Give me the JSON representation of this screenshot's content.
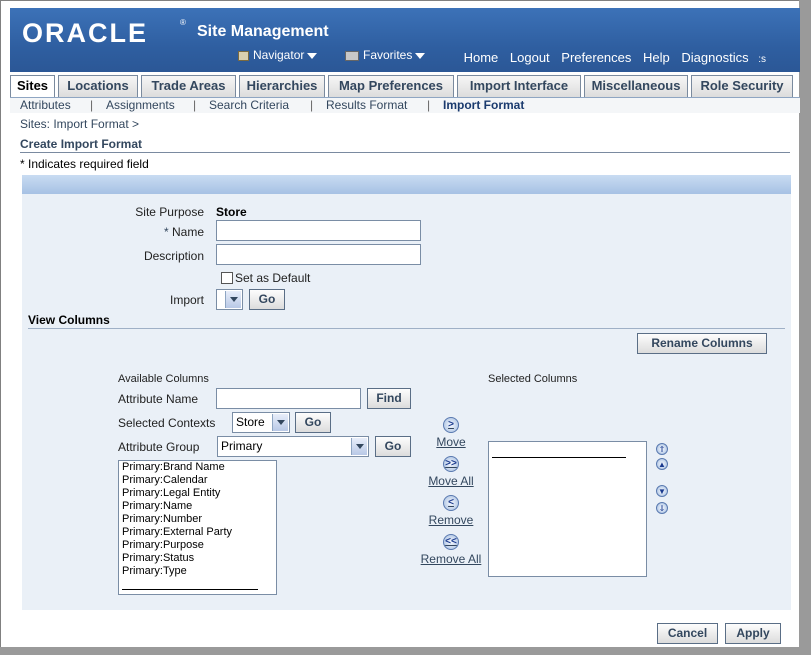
{
  "header": {
    "logo_text": "ORACLE",
    "logo_tm": "®",
    "app_title": "Site Management",
    "navigator_label": "Navigator",
    "favorites_label": "Favorites",
    "links": [
      "Home",
      "Logout",
      "Preferences",
      "Help",
      "Diagnostics"
    ],
    "overflow": ":s"
  },
  "tabs": [
    "Sites",
    "Locations",
    "Trade Areas",
    "Hierarchies",
    "Map Preferences",
    "Import Interface",
    "Miscellaneous",
    "Role Security"
  ],
  "subtabs": [
    "Attributes",
    "Assignments",
    "Search Criteria",
    "Results Format",
    "Import Format"
  ],
  "breadcrumb": "Sites: Import Format  >",
  "page_title": "Create Import Format",
  "required_note": "*  Indicates required field",
  "form": {
    "site_purpose_label": "Site Purpose",
    "site_purpose_value": "Store",
    "name_label": "Name",
    "name_required": "*",
    "name_value": "",
    "description_label": "Description",
    "description_value": "",
    "set_default_label": "Set as Default",
    "import_label": "Import",
    "go_label": "Go"
  },
  "view_columns": {
    "title": "View Columns",
    "rename_button": "Rename Columns",
    "available_label": "Available Columns",
    "selected_label": "Selected Columns",
    "attribute_name_label": "Attribute Name",
    "attribute_name_value": "",
    "find_button": "Find",
    "selected_contexts_label": "Selected Contexts",
    "selected_contexts_value": "Store",
    "attribute_group_label": "Attribute Group",
    "attribute_group_value": "Primary",
    "go_label": "Go",
    "available_items": [
      "Primary:Brand Name",
      "Primary:Calendar",
      "Primary:Legal Entity",
      "Primary:Name",
      "Primary:Number",
      "Primary:External Party",
      "Primary:Purpose",
      "Primary:Status",
      "Primary:Type"
    ],
    "shuttle": {
      "move": "Move",
      "move_all": "Move All",
      "remove": "Remove",
      "remove_all": "Remove All"
    }
  },
  "buttons": {
    "cancel": "Cancel",
    "apply": "Apply"
  }
}
